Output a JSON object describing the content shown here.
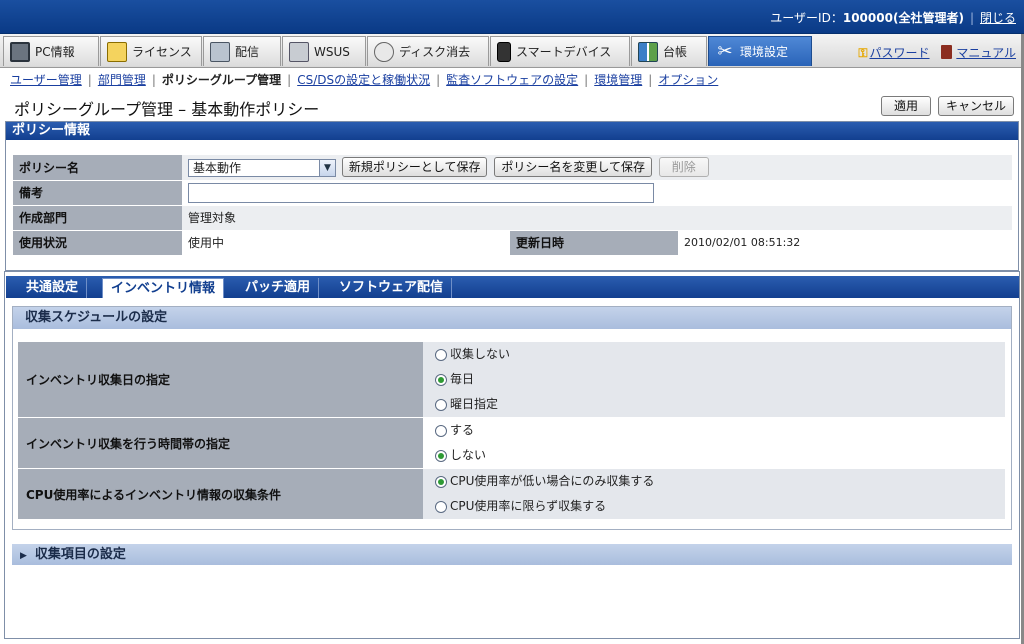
{
  "header": {
    "user_label": "ユーザーID：",
    "user_id": "100000",
    "user_role": "(全社管理者)",
    "close_link": "閉じる"
  },
  "main_tabs": [
    {
      "label": "PC情報",
      "icon": "pc-icon"
    },
    {
      "label": "ライセンス",
      "icon": "license-icon"
    },
    {
      "label": "配信",
      "icon": "distribution-icon"
    },
    {
      "label": "WSUS",
      "icon": "wsus-icon"
    },
    {
      "label": "ディスク消去",
      "icon": "disk-erase-icon"
    },
    {
      "label": "スマートデバイス",
      "icon": "smart-device-icon"
    },
    {
      "label": "台帳",
      "icon": "ledger-icon"
    },
    {
      "label": "環境設定",
      "icon": "tools-icon",
      "active": true
    }
  ],
  "nav_links": {
    "password": "パスワード",
    "manual": "マニュアル"
  },
  "sub_nav": [
    {
      "label": "ユーザー管理",
      "current": false
    },
    {
      "label": "部門管理",
      "current": false
    },
    {
      "label": "ポリシーグループ管理",
      "current": true
    },
    {
      "label": "CS/DSの設定と稼働状況",
      "current": false
    },
    {
      "label": "監査ソフトウェアの設定",
      "current": false
    },
    {
      "label": "環境管理",
      "current": false
    },
    {
      "label": "オプション",
      "current": false
    }
  ],
  "page": {
    "title": "ポリシーグループ管理 – 基本動作ポリシー",
    "apply_button": "適用",
    "cancel_button": "キャンセル"
  },
  "policy_info": {
    "section_title": "ポリシー情報",
    "policy_name_label": "ポリシー名",
    "policy_name_value": "基本動作",
    "save_new_button": "新規ポリシーとして保存",
    "rename_save_button": "ポリシー名を変更して保存",
    "delete_button": "削除",
    "remarks_label": "備考",
    "remarks_value": "",
    "dept_label": "作成部門",
    "dept_value": "管理対象",
    "usage_label": "使用状況",
    "usage_value": "使用中",
    "updated_label": "更新日時",
    "updated_value": "2010/02/01 08:51:32"
  },
  "settings_tabs": [
    {
      "label": "共通設定",
      "active": false
    },
    {
      "label": "インベントリ情報",
      "active": true
    },
    {
      "label": "パッチ適用",
      "active": false
    },
    {
      "label": "ソフトウェア配信",
      "active": false
    }
  ],
  "schedule": {
    "title": "収集スケジュールの設定",
    "rows": [
      {
        "label": "インベントリ収集日の指定",
        "options": [
          {
            "label": "収集しない",
            "selected": false
          },
          {
            "label": "毎日",
            "selected": true
          },
          {
            "label": "曜日指定",
            "selected": false
          }
        ]
      },
      {
        "label": "インベントリ収集を行う時間帯の指定",
        "options": [
          {
            "label": "する",
            "selected": false
          },
          {
            "label": "しない",
            "selected": true
          }
        ]
      },
      {
        "label": "CPU使用率によるインベントリ情報の収集条件",
        "options": [
          {
            "label": "CPU使用率が低い場合にのみ収集する",
            "selected": true
          },
          {
            "label": "CPU使用率に限らず収集する",
            "selected": false
          }
        ]
      }
    ]
  },
  "collect_items": {
    "title": "収集項目の設定",
    "expanded": false
  }
}
